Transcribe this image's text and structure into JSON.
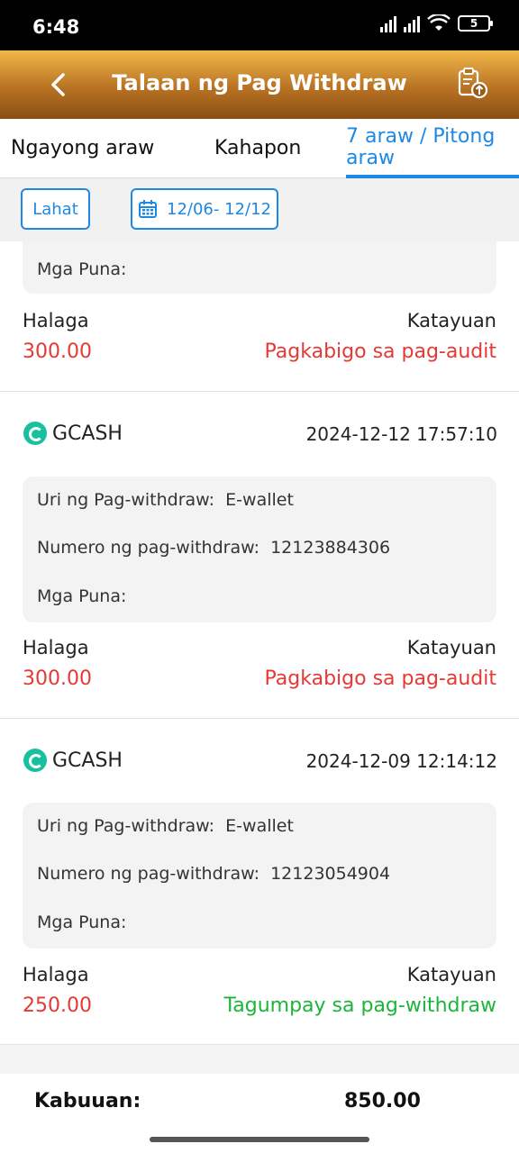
{
  "status_bar": {
    "time": "6:48",
    "battery": "5"
  },
  "header": {
    "title": "Talaan ng Pag Withdraw"
  },
  "tabs": [
    {
      "label": "Ngayong araw"
    },
    {
      "label": "Kahapon"
    },
    {
      "label": "7 araw / Pitong araw",
      "active": true
    }
  ],
  "filters": {
    "all_label": "Lahat",
    "date_range": "12/06- 12/12"
  },
  "partial_record": {
    "remarks_label": "Mga Puna:",
    "amount_label": "Halaga",
    "amount": "300.00",
    "status_label": "Katayuan",
    "status": "Pagkabigo sa pag-audit"
  },
  "records": [
    {
      "provider": "GCASH",
      "datetime": "2024-12-12 17:57:10",
      "type_label": "Uri ng Pag-withdraw:",
      "type_value": "E-wallet",
      "number_label": "Numero ng pag-withdraw:",
      "number_value": "12123884306",
      "remarks_label": "Mga Puna:",
      "amount_label": "Halaga",
      "amount": "300.00",
      "status_label": "Katayuan",
      "status": "Pagkabigo sa pag-audit"
    },
    {
      "provider": "GCASH",
      "datetime": "2024-12-09 12:14:12",
      "type_label": "Uri ng Pag-withdraw:",
      "type_value": "E-wallet",
      "number_label": "Numero ng pag-withdraw:",
      "number_value": "12123054904",
      "remarks_label": "Mga Puna:",
      "amount_label": "Halaga",
      "amount": "250.00",
      "status_label": "Katayuan",
      "status": "Tagumpay sa pag-withdraw"
    }
  ],
  "footer": {
    "total_label": "Kabuuan:",
    "total_value": "850.00"
  },
  "colors": {
    "accent": "#1e88e5",
    "failure": "#e53935",
    "success": "#1bb53a",
    "header_top": "#f2b84a",
    "header_bottom": "#8a4f12"
  }
}
